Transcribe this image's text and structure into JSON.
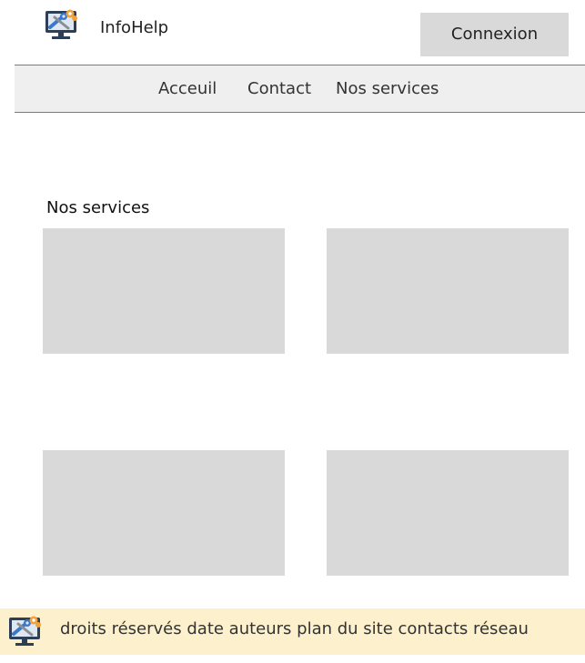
{
  "header": {
    "brand": "InfoHelp",
    "login_label": "Connexion"
  },
  "nav": {
    "items": [
      {
        "label": "Acceuil"
      },
      {
        "label": "Contact"
      },
      {
        "label": "Nos services"
      }
    ]
  },
  "services": {
    "title": "Nos services"
  },
  "footer": {
    "text": "droits réservés date auteurs plan du site contacts réseau"
  },
  "colors": {
    "button_bg": "#d9d9d9",
    "nav_bg": "#efefef",
    "card_bg": "#d9d9d9",
    "footer_bg": "#fdf0cd"
  },
  "icons": {
    "logo": "computer-repair-icon"
  }
}
